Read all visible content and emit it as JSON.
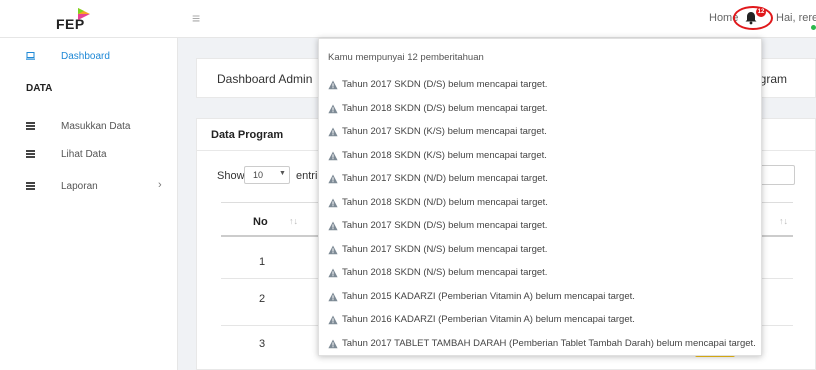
{
  "brand": {
    "logo_text": "FEP"
  },
  "topbar": {
    "menu_icon": "hamburger-icon",
    "home_label": "Home",
    "bell_icon": "bell-icon",
    "badge_count": "12",
    "user_greeting": "Hai, rere",
    "colors": {
      "badge": "#e0181b",
      "online": "#2db84d"
    }
  },
  "sidebar": {
    "items": [
      {
        "label": "Dashboard",
        "icon": "laptop-icon",
        "active": true
      },
      {
        "label": "Masukkan Data",
        "icon": "table-icon"
      },
      {
        "label": "Lihat Data",
        "icon": "table-icon"
      },
      {
        "label": "Laporan",
        "icon": "table-icon"
      }
    ],
    "section_header": "DATA",
    "accent": "#1e88d6"
  },
  "header": {
    "title": "Dashboard Admin",
    "right_text": "rogram"
  },
  "data_card": {
    "title": "Data Program",
    "show_label": "Show",
    "page_size": "10",
    "entries_label": "entri",
    "columns": [
      "No"
    ],
    "rows": [
      "1",
      "2",
      "3"
    ]
  },
  "notifications": {
    "header": "Kamu mempunyai 12 pemberitahuan",
    "items": [
      "Tahun 2017 SKDN (D/S) belum mencapai target.",
      "Tahun 2018 SKDN (D/S) belum mencapai target.",
      "Tahun 2017 SKDN (K/S) belum mencapai target.",
      "Tahun 2018 SKDN (K/S) belum mencapai target.",
      "Tahun 2017 SKDN (N/D) belum mencapai target.",
      "Tahun 2018 SKDN (N/D) belum mencapai target.",
      "Tahun 2017 SKDN (D/S) belum mencapai target.",
      "Tahun 2017 SKDN (N/S) belum mencapai target.",
      "Tahun 2018 SKDN (N/S) belum mencapai target.",
      "Tahun 2015 KADARZI (Pemberian Vitamin A) belum mencapai target.",
      "Tahun 2016 KADARZI (Pemberian Vitamin A) belum mencapai target.",
      "Tahun 2017 TABLET TAMBAH DARAH (Pemberian Tablet Tambah Darah) belum mencapai target."
    ],
    "icon": "warning-icon"
  }
}
